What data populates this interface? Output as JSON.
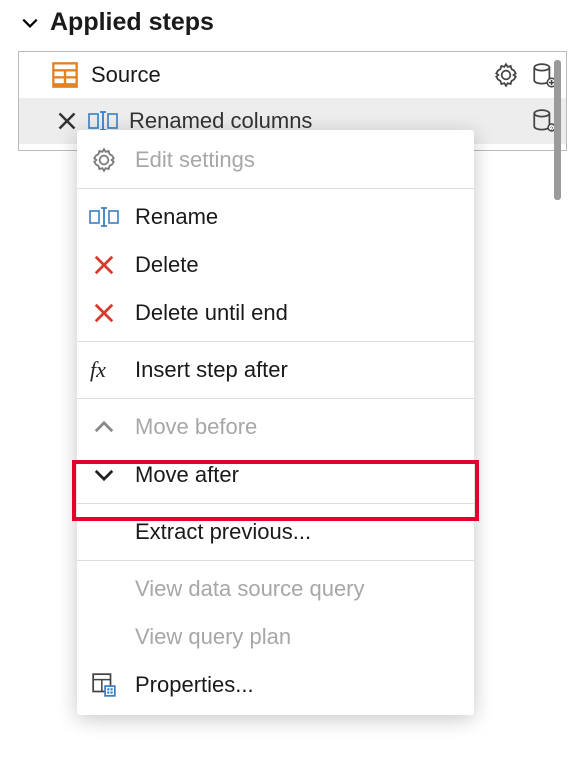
{
  "header": {
    "title": "Applied steps"
  },
  "steps": [
    {
      "label": "Source"
    },
    {
      "label": "Renamed columns"
    }
  ],
  "menu": {
    "edit_settings": "Edit settings",
    "rename": "Rename",
    "delete": "Delete",
    "delete_until_end": "Delete until end",
    "insert_step_after": "Insert step after",
    "move_before": "Move before",
    "move_after": "Move after",
    "extract_previous": "Extract previous...",
    "view_data_source_query": "View data source query",
    "view_query_plan": "View query plan",
    "properties": "Properties..."
  }
}
